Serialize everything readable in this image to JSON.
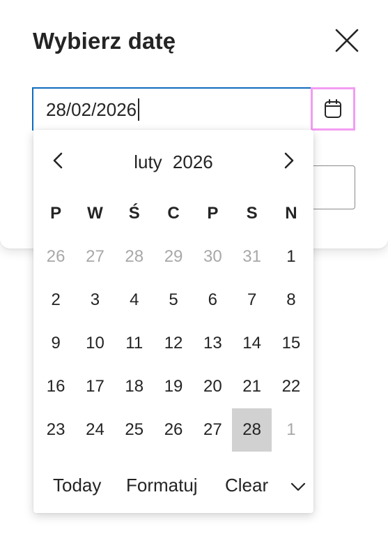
{
  "dialog": {
    "title": "Wybierz datę"
  },
  "date_input": {
    "value": "28/02/2026"
  },
  "calendar": {
    "month": "luty",
    "year": "2026",
    "weekdays": [
      "P",
      "W",
      "Ś",
      "C",
      "P",
      "S",
      "N"
    ],
    "weeks": [
      [
        "26",
        "27",
        "28",
        "29",
        "30",
        "31",
        "1"
      ],
      [
        "2",
        "3",
        "4",
        "5",
        "6",
        "7",
        "8"
      ],
      [
        "9",
        "10",
        "11",
        "12",
        "13",
        "14",
        "15"
      ],
      [
        "16",
        "17",
        "18",
        "19",
        "20",
        "21",
        "22"
      ],
      [
        "23",
        "24",
        "25",
        "26",
        "27",
        "28",
        "1"
      ]
    ],
    "selected_day": "28",
    "footer": {
      "today": "Today",
      "format": "Formatuj",
      "clear": "Clear"
    }
  },
  "colors": {
    "focus_border": "#0f6cbd",
    "highlight_border": "#f39cf3",
    "selected_bg": "#d1d1d1",
    "muted_text": "#a8a8a8"
  },
  "icons": {
    "close": "close-icon",
    "calendar": "calendar-icon",
    "prev": "chevron-left-icon",
    "next": "chevron-right-icon",
    "expand": "chevron-down-icon"
  }
}
